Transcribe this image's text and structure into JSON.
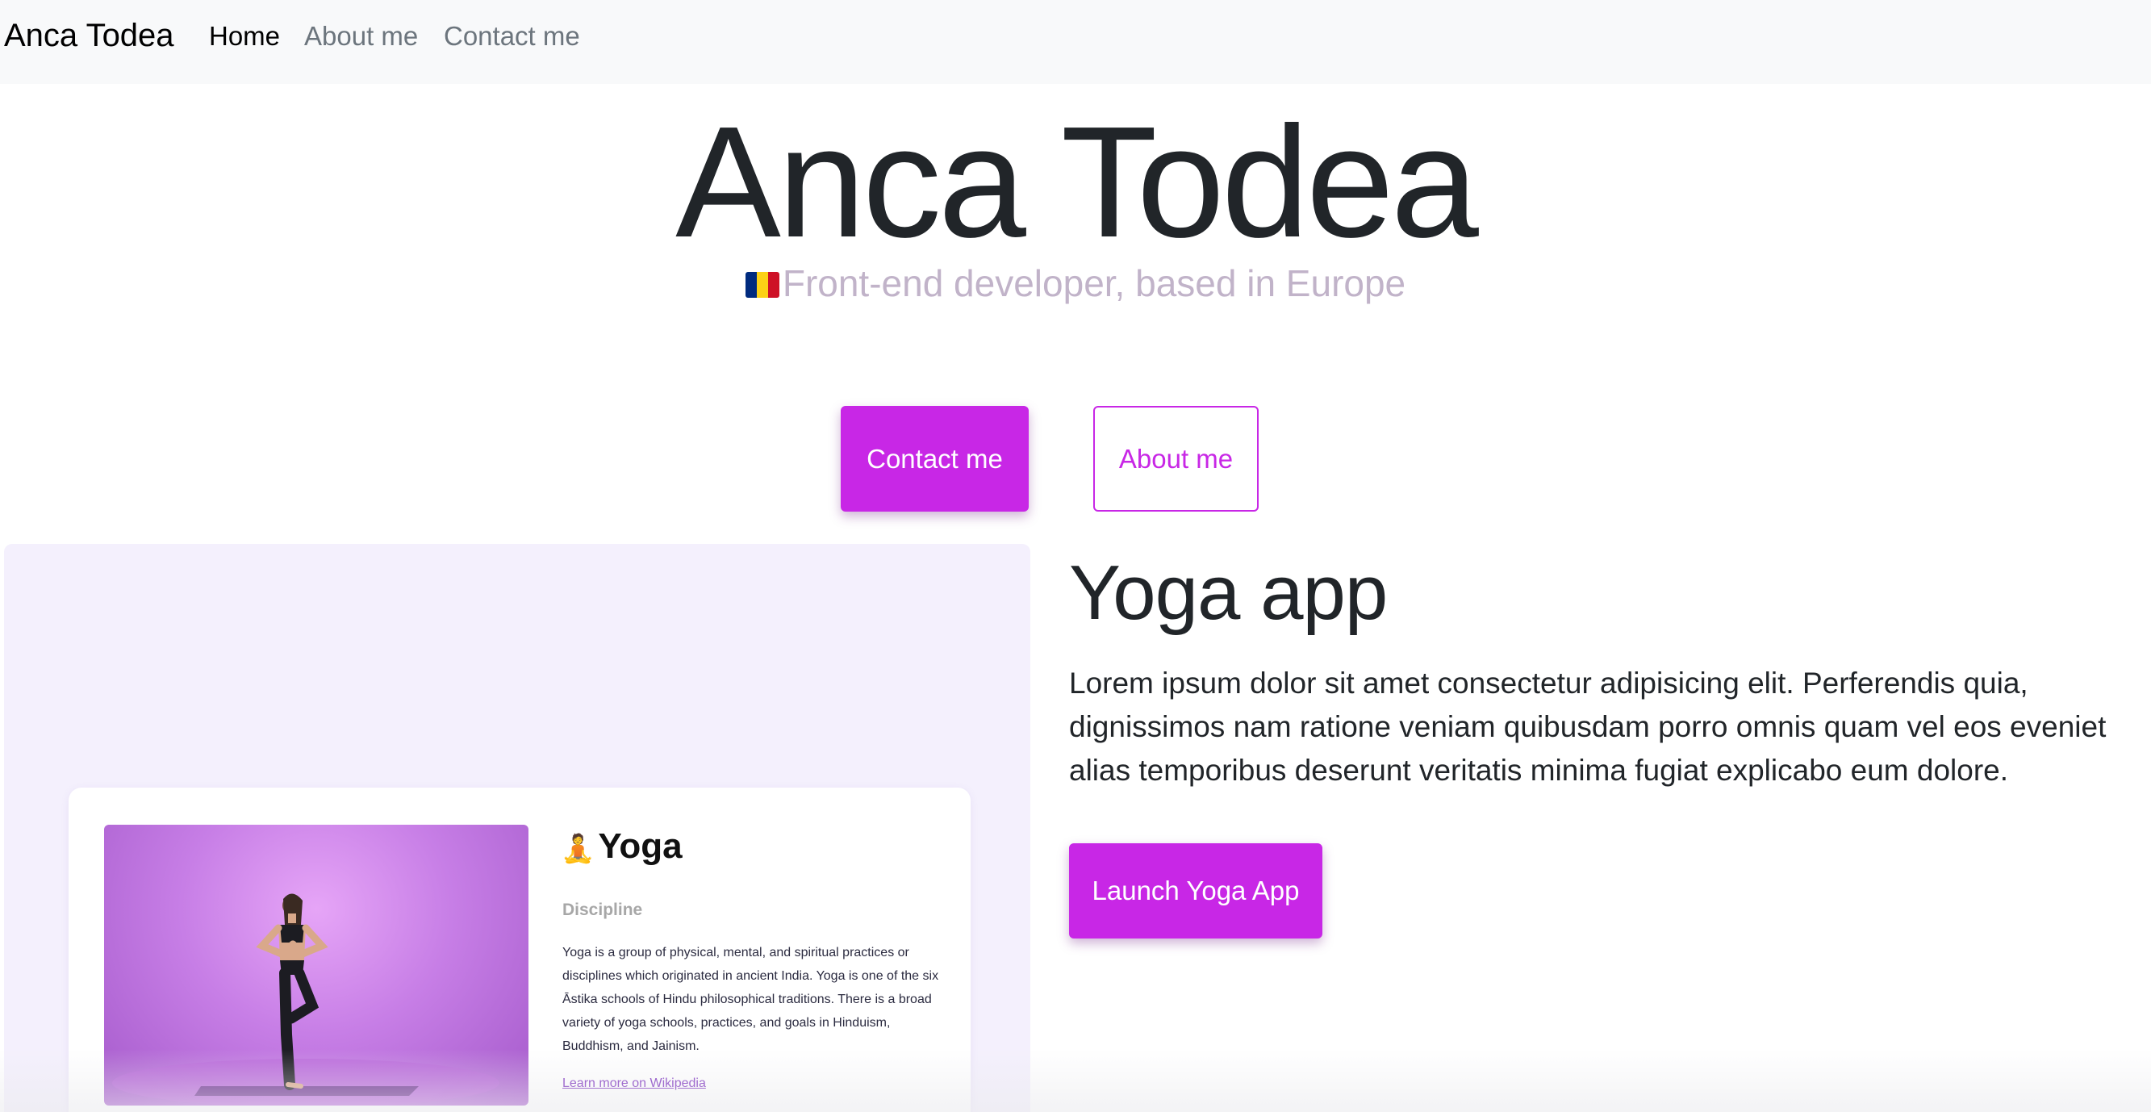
{
  "nav": {
    "brand": "Anca Todea",
    "items": [
      {
        "label": "Home",
        "active": true
      },
      {
        "label": "About me",
        "active": false
      },
      {
        "label": "Contact me",
        "active": false
      }
    ]
  },
  "hero": {
    "title": "Anca Todea",
    "subtitle": "Front-end developer, based in Europe",
    "flag_icon": "romania-flag-icon",
    "contact_button": "Contact me",
    "about_button": "About me"
  },
  "project": {
    "title": "Yoga app",
    "description": "Lorem ipsum dolor sit amet consectetur adipisicing elit. Perferendis quia, dignissimos nam ratione veniam quibusdam porro omnis quam vel eos eveniet alias temporibus deserunt veritatis minima fugiat explicabo eum dolore.",
    "launch_button": "Launch Yoga App",
    "preview": {
      "title": "Yoga",
      "title_icon": "lotus-position-icon",
      "tag": "Discipline",
      "text": "Yoga is a group of physical, mental, and spiritual practices or disciplines which originated in ancient India. Yoga is one of the six Āstika schools of Hindu philosophical traditions. There is a broad variety of yoga schools, practices, and goals in Hinduism, Buddhism, and Jainism.",
      "link": "Learn more on Wikipedia"
    }
  },
  "colors": {
    "accent": "#c827e6",
    "navbar_bg": "#f8f9fa",
    "subtitle": "#c1b3c9",
    "showcase_bg": "#f4f0fd"
  }
}
